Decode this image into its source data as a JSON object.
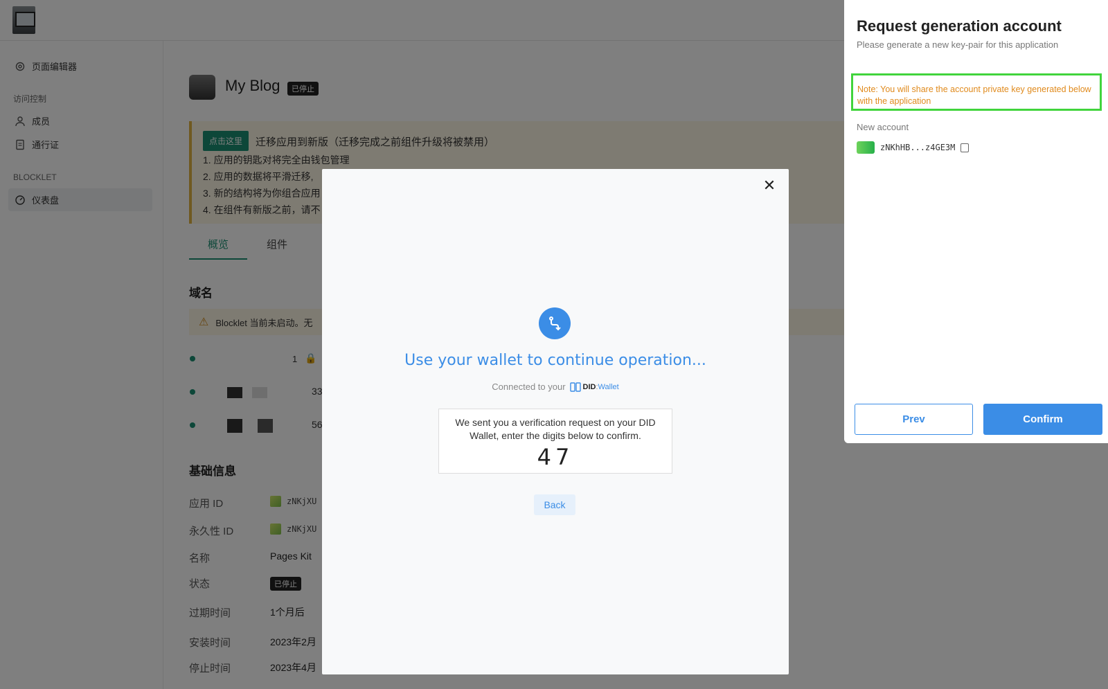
{
  "sidebar": {
    "items": [
      {
        "label": "页面编辑器"
      },
      {
        "label": "成员"
      },
      {
        "label": "通行证"
      },
      {
        "label": "仪表盘"
      }
    ],
    "section_access": "访问控制",
    "section_blocklet": "BLOCKLET"
  },
  "app": {
    "title": "My Blog",
    "status_badge": "已停止"
  },
  "notice": {
    "button": "点击这里",
    "headline": "迁移应用到新版（迁移完成之前组件升级将被禁用）",
    "lines": [
      "1. 应用的钥匙对将完全由钱包管理",
      "2. 应用的数据将平滑迁移,",
      "3. 新的结构将为你组合应用",
      "4. 在组件有新版之前，请不"
    ]
  },
  "tabs": [
    {
      "label": "概览"
    },
    {
      "label": "组件"
    }
  ],
  "domain": {
    "title": "域名",
    "warning": "Blocklet 当前未启动。无",
    "row1_suffix": "1",
    "row2_suffix": "33",
    "row3_suffix": "56"
  },
  "basic_info": {
    "title": "基础信息",
    "rows": [
      {
        "label": "应用 ID",
        "value": "zNKjXU"
      },
      {
        "label": "永久性 ID",
        "value": "zNKjXU"
      },
      {
        "label": "名称",
        "value": "Pages Kit"
      },
      {
        "label": "状态",
        "value": "已停止"
      },
      {
        "label": "过期时间",
        "value": "1个月后"
      },
      {
        "label": "安装时间",
        "value": "2023年2月"
      },
      {
        "label": "停止时间",
        "value": "2023年4月"
      }
    ]
  },
  "dialog": {
    "title": "Use your wallet to continue operation...",
    "connected_prefix": "Connected to your",
    "did_brand": "DID",
    "did_wallet": "Wallet",
    "verify_text": "We sent you a verification request on your DID Wallet, enter the digits below to confirm.",
    "digits": "47",
    "back_label": "Back"
  },
  "panel": {
    "title": "Request generation account",
    "subtitle": "Please generate a new key-pair for this application",
    "note": "Note: You will share the account private key generated below with the application",
    "new_account_label": "New account",
    "account": "zNKhHB...z4GE3M",
    "prev_label": "Prev",
    "confirm_label": "Confirm"
  },
  "colors": {
    "accent": "#3b8de6",
    "brand_green": "#1a8e72",
    "note_orange": "#e08a1c",
    "highlight_green": "#41d43c"
  }
}
